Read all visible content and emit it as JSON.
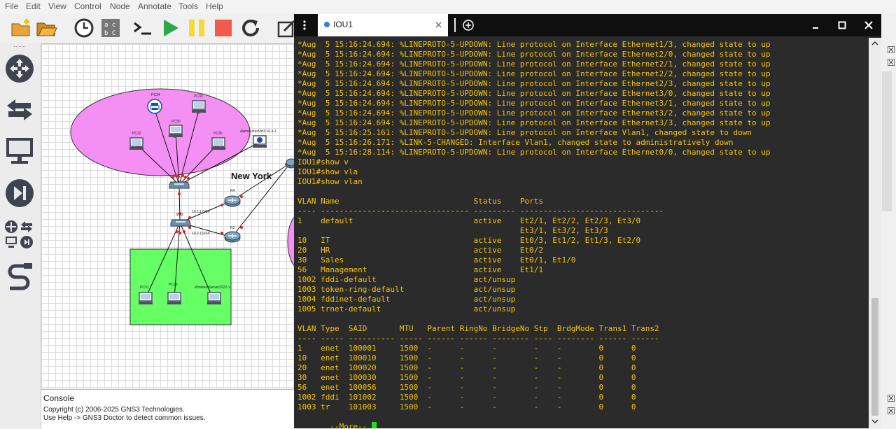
{
  "menu": [
    "File",
    "Edit",
    "View",
    "Control",
    "Node",
    "Annotate",
    "Tools",
    "Help"
  ],
  "canvas": {
    "labels": {
      "pc34": "PC34",
      "pc33": "PC33",
      "pc30": "PC30",
      "pc32": "PC32",
      "pc26": "PC26",
      "alpine": "AlpineLinuxVirt3.16.4-1",
      "newyork": "New York",
      "r4": "R4",
      "r2": "R2",
      "sw2": "SW2",
      "net1": "10.1.1.0/24",
      "net2": "10.2.1.0/24",
      "pc31": "PC31",
      "pc29": "PC29",
      "winsrv": "WindowsServer2022-1"
    }
  },
  "console": {
    "title": "Console",
    "lines": [
      "Copyright (c) 2006-2025 GNS3 Technologies.",
      "Use Help -> GNS3 Doctor to detect common issues."
    ]
  },
  "terminal": {
    "tab_label": "IOU1",
    "lines": [
      "*Aug  5 15:16:24.694: %LINEPROTO-5-UPDOWN: Line protocol on Interface Ethernet1/3, changed state to up",
      "*Aug  5 15:16:24.694: %LINEPROTO-5-UPDOWN: Line protocol on Interface Ethernet2/0, changed state to up",
      "*Aug  5 15:16:24.694: %LINEPROTO-5-UPDOWN: Line protocol on Interface Ethernet2/1, changed state to up",
      "*Aug  5 15:16:24.694: %LINEPROTO-5-UPDOWN: Line protocol on Interface Ethernet2/2, changed state to up",
      "*Aug  5 15:16:24.694: %LINEPROTO-5-UPDOWN: Line protocol on Interface Ethernet2/3, changed state to up",
      "*Aug  5 15:16:24.694: %LINEPROTO-5-UPDOWN: Line protocol on Interface Ethernet3/0, changed state to up",
      "*Aug  5 15:16:24.694: %LINEPROTO-5-UPDOWN: Line protocol on Interface Ethernet3/1, changed state to up",
      "*Aug  5 15:16:24.694: %LINEPROTO-5-UPDOWN: Line protocol on Interface Ethernet3/2, changed state to up",
      "*Aug  5 15:16:24.694: %LINEPROTO-5-UPDOWN: Line protocol on Interface Ethernet3/3, changed state to up",
      "*Aug  5 15:16:25.161: %LINEPROTO-5-UPDOWN: Line protocol on Interface Vlan1, changed state to down",
      "*Aug  5 15:16:26.171: %LINK-5-CHANGED: Interface Vlan1, changed state to administratively down",
      "*Aug  5 15:16:28.114: %LINEPROTO-5-UPDOWN: Line protocol on Interface Ethernet0/0, changed state to up",
      "IOU1#show v",
      "IOU1#show vla",
      "IOU1#show vlan",
      "",
      "VLAN Name                             Status    Ports",
      "---- -------------------------------- --------- -------------------------------",
      "1    default                          active    Et2/1, Et2/2, Et2/3, Et3/0",
      "                                                Et3/1, Et3/2, Et3/3",
      "10   IT                               active    Et0/3, Et1/2, Et1/3, Et2/0",
      "20   HR                               active    Et0/2",
      "30   Sales                            active    Et0/1, Et1/0",
      "56   Management                       active    Et1/1",
      "1002 fddi-default                     act/unsup",
      "1003 token-ring-default               act/unsup",
      "1004 fddinet-default                  act/unsup",
      "1005 trnet-default                    act/unsup",
      "",
      "VLAN Type  SAID       MTU   Parent RingNo BridgeNo Stp  BrdgMode Trans1 Trans2",
      "---- ----- ---------- ----- ------ ------ -------- ---- -------- ------ ------",
      "1    enet  100001     1500  -      -      -        -    -        0      0",
      "10   enet  100010     1500  -      -      -        -    -        0      0",
      "20   enet  100020     1500  -      -      -        -    -        0      0",
      "30   enet  100030     1500  -      -      -        -    -        0      0",
      "56   enet  100056     1500  -      -      -        -    -        0      0",
      "1002 fddi  101002     1500  -      -      -        -    -        0      0",
      "1003 tr    101003     1500  -      -      -        -    -        0      0"
    ],
    "more_prompt": " --More-- ",
    "colors": {
      "text": "#f5c400",
      "background": "#2b2b2b",
      "cursor": "#22dd22"
    }
  }
}
